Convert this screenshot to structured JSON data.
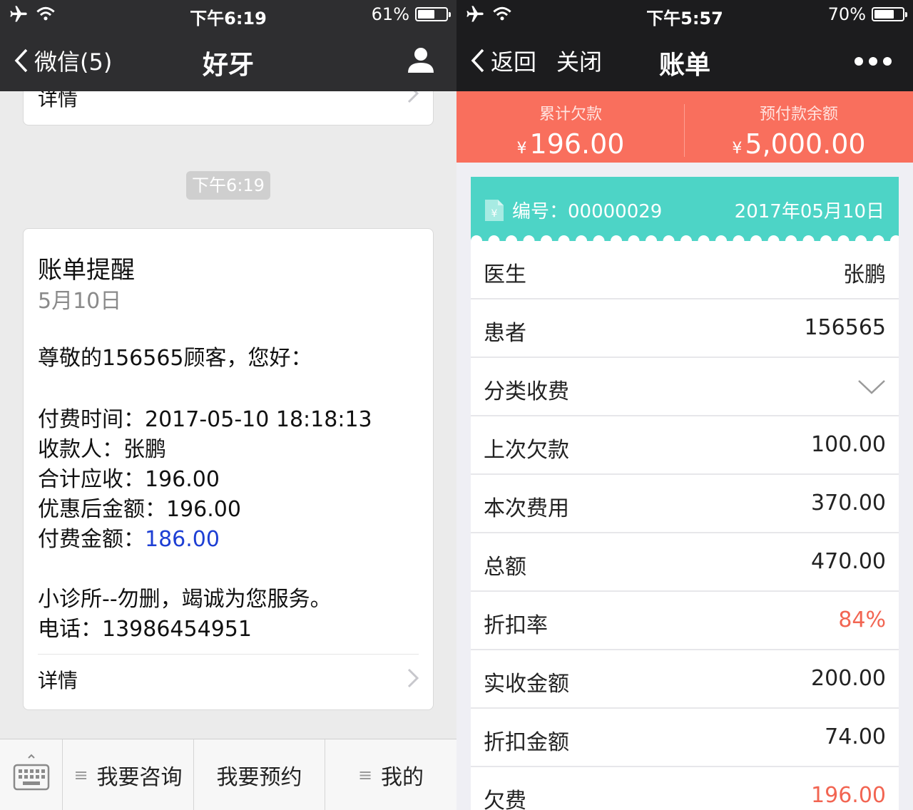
{
  "left": {
    "status": {
      "time": "下午6:19",
      "battery": "61%",
      "battery_level": 0.61
    },
    "nav": {
      "back_label": "微信(5)",
      "title": "好牙"
    },
    "prev_card": {
      "detail_label": "详情"
    },
    "time_badge": "下午6:19",
    "message": {
      "title": "账单提醒",
      "date": "5月10日",
      "greeting": "尊敬的156565顾客，您好：",
      "pay_time": "付费时间：2017-05-10 18:18:13",
      "payee": "收款人：张鹏",
      "total_due": "合计应收：196.00",
      "after_discount": "优惠后金额：196.00",
      "paid_label": "付费金额：",
      "paid_value": "186.00",
      "clinic": "小诊所--勿删，竭诚为您服务。",
      "phone": "电话：13986454951",
      "detail_label": "详情"
    },
    "bottom_menu": [
      "我要咨询",
      "我要预约",
      "我的"
    ]
  },
  "right": {
    "status": {
      "time": "下午5:57",
      "battery": "70%",
      "battery_level": 0.7
    },
    "nav": {
      "back_label": "返回",
      "close_label": "关闭",
      "title": "账单"
    },
    "summary": {
      "debt_label": "累计欠款",
      "debt_currency": "¥",
      "debt_value": "196.00",
      "prepaid_label": "预付款余额",
      "prepaid_currency": "¥",
      "prepaid_value": "5,000.00"
    },
    "bill": {
      "number_label": "编号：00000029",
      "date": "2017年05月10日"
    },
    "rows": [
      {
        "key": "医生",
        "value": "张鹏"
      },
      {
        "key": "患者",
        "value": "156565"
      },
      {
        "key": "分类收费",
        "value": ""
      },
      {
        "key": "上次欠款",
        "value": "100.00"
      },
      {
        "key": "本次费用",
        "value": "370.00"
      },
      {
        "key": "总额",
        "value": "470.00"
      },
      {
        "key": "折扣率",
        "value": "84%"
      },
      {
        "key": "实收金额",
        "value": "200.00"
      },
      {
        "key": "折扣金额",
        "value": "74.00"
      },
      {
        "key": "欠费",
        "value": "196.00"
      }
    ],
    "colors": {
      "summary_bg": "#f96f5d",
      "bill_header_bg": "#4dd4c6",
      "highlight_red": "#f26552"
    }
  }
}
